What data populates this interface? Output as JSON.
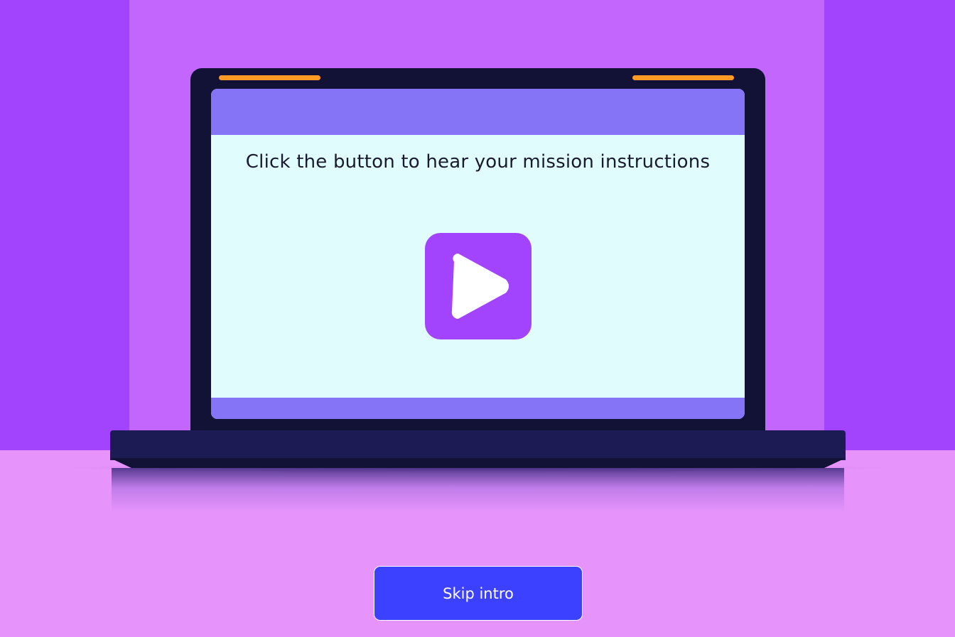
{
  "screen": {
    "message": "Click the button to hear your mission instructions",
    "play_button": {
      "icon": "play-icon"
    }
  },
  "actions": {
    "skip_label": "Skip intro"
  },
  "colors": {
    "wall_dark": "#a244fe",
    "wall_light": "#c366fe",
    "floor": "#e694fb",
    "laptop_frame": "#121237",
    "laptop_base": "#1c1b54",
    "screen_bar": "#8574f5",
    "screen_bg": "#e0fcfd",
    "accent_orange": "#ff9a27",
    "play_button": "#a244fe",
    "skip_button": "#3b41ff"
  }
}
